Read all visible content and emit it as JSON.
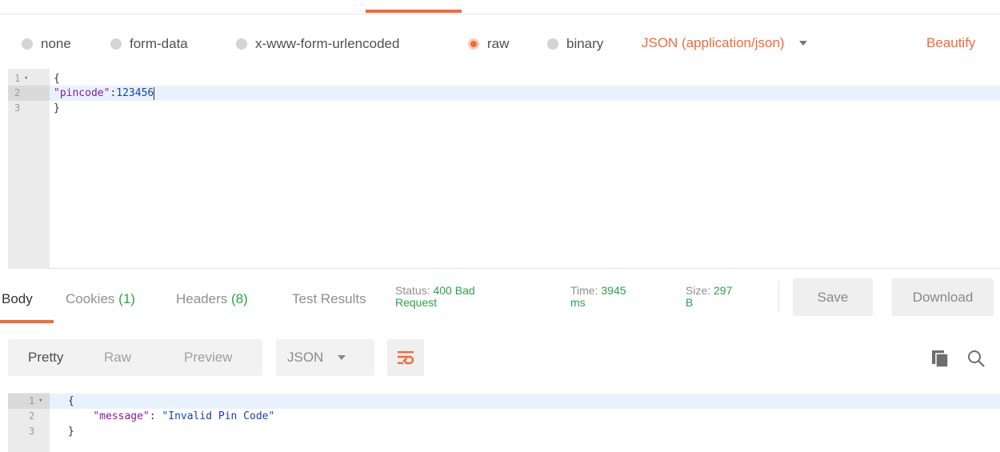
{
  "body_types": {
    "options": [
      {
        "label": "none",
        "selected": false
      },
      {
        "label": "form-data",
        "selected": false
      },
      {
        "label": "x-www-form-urlencoded",
        "selected": false
      },
      {
        "label": "raw",
        "selected": true
      },
      {
        "label": "binary",
        "selected": false
      }
    ],
    "content_type": "JSON (application/json)",
    "beautify": "Beautify"
  },
  "request_editor": {
    "lines": [
      {
        "num": "1",
        "fold": "▾",
        "text": "{"
      },
      {
        "num": "2",
        "fold": "",
        "key": "\"pincode\"",
        "colon": ":",
        "value": "123456"
      },
      {
        "num": "3",
        "fold": "",
        "text": "}"
      }
    ]
  },
  "response_tabs": {
    "body": "Body",
    "cookies": "Cookies",
    "cookies_count": "(1)",
    "headers": "Headers",
    "headers_count": "(8)",
    "test_results": "Test Results"
  },
  "response_stats": {
    "status_label": "Status:",
    "status_value_1": "400 Bad",
    "status_value_2": "Request",
    "time_label": "Time:",
    "time_value_1": "3945",
    "time_value_2": "ms",
    "size_label": "Size:",
    "size_value_1": "297",
    "size_value_2": "B"
  },
  "actions": {
    "save": "Save",
    "download": "Download"
  },
  "view_modes": {
    "pretty": "Pretty",
    "raw": "Raw",
    "preview": "Preview",
    "format": "JSON"
  },
  "icons": {
    "wrap": "wrap-lines-icon",
    "copy": "copy-icon",
    "search": "search-icon"
  },
  "colors": {
    "accent": "#f26b3a",
    "success": "#2aa14b"
  },
  "response_editor": {
    "lines": [
      {
        "num": "1",
        "fold": "▾",
        "text": "{"
      },
      {
        "num": "2",
        "fold": "",
        "key": "\"message\"",
        "colon": ": ",
        "value": "\"Invalid Pin Code\""
      },
      {
        "num": "3",
        "fold": "",
        "text": "}"
      }
    ]
  }
}
